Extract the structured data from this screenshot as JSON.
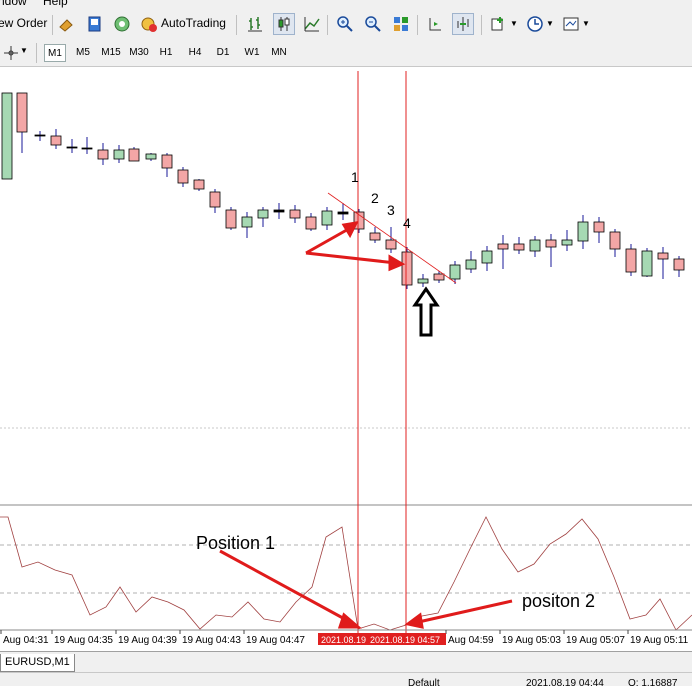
{
  "menu": {
    "items": [
      "ndow",
      "Help"
    ]
  },
  "toolbar": {
    "new_order_label": "ew Order",
    "autotrading_label": "AutoTrading",
    "icons": [
      "new-order-icon",
      "metaeditor-icon",
      "market-watch-icon",
      "signals-icon",
      "autotrading-icon",
      "bar-chart-icon",
      "candlestick-icon",
      "line-chart-icon",
      "zoom-in-icon",
      "zoom-out-icon",
      "tile-windows-icon",
      "chart-shift-icon",
      "autoscroll-icon",
      "indicators-icon",
      "periodicity-icon",
      "templates-icon"
    ]
  },
  "timeframes": {
    "items": [
      "M1",
      "M5",
      "M15",
      "M30",
      "H1",
      "H4",
      "D1",
      "W1",
      "MN"
    ],
    "active": "M1"
  },
  "chart": {
    "symbol_tab": "EURUSD,M1",
    "colors": {
      "bull": "#a6d9b3",
      "bear": "#f3a6a6",
      "wick": "#1a1a99",
      "annotation": "#e01b1b",
      "vline": "#e02020"
    },
    "annotations": {
      "n1": "1",
      "n2": "2",
      "n3": "3",
      "n4": "4"
    },
    "osc_labels": {
      "position1": "Position 1",
      "position2": "positon 2"
    },
    "time_axis": [
      "Aug 04:31",
      "19 Aug 04:35",
      "19 Aug 04:39",
      "19 Aug 04:43",
      "19 Aug 04:47",
      "Aug 04:59",
      "19 Aug 05:03",
      "19 Aug 05:07",
      "19 Aug 05:11"
    ],
    "crosshair_labels": [
      "2021.08.19",
      "2021.08.19 04:57"
    ]
  },
  "status": {
    "profile": "Default",
    "datetime": "2021.08.19 04:44",
    "open": "O: 1.16887"
  }
}
